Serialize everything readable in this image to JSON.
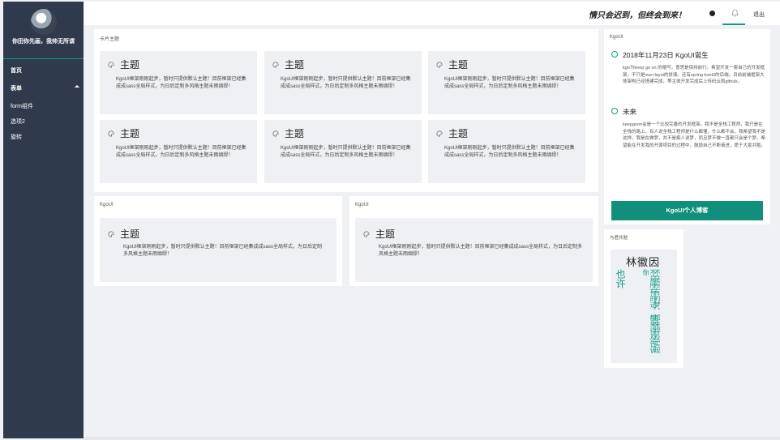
{
  "sidebar": {
    "user_name": "你田你先画，我帅无所谓",
    "items": [
      {
        "label": "首页"
      },
      {
        "label": "表单"
      },
      {
        "label": "form组件"
      },
      {
        "label": "选项2"
      },
      {
        "label": "旋转"
      }
    ]
  },
  "header": {
    "slogan": "情只会迟到，但终会到来！",
    "logout": "退出"
  },
  "theme_panel": {
    "title": "卡片主题",
    "card_title": "主题",
    "card_text": "KgoUI框架刚刚起步，暂时只提供默认主题！目前框架已经集成成sass全局样式，为日后定制多风格主题未雨绸缪！"
  },
  "panel_left": {
    "title": "KgoUI",
    "card_title": "主题",
    "card_text": "KgoUI框架刚刚起步，暂时只提供默认主题！目前框架已经集成成sass全局样式，为日后定制多风格主题未雨绸缪！"
  },
  "panel_right": {
    "title": "KgoUI",
    "card_title": "主题",
    "card_text": "KgoUI框架刚刚起步，暂时只提供默认主题！目前框架已经集成成sass全局样式，为日后定制多风格主题未雨绸缪！"
  },
  "timeline": {
    "title": "KgoUI",
    "item1_title": "2018年11月23日 KgoUI诞生",
    "item1_text": "kgo为keep go on 的缩写，意思是保持前行。希望开发一套自己的开发框架，不只是vue+layui的拼凑。还有spring boot2的后端。目前前端框架大体架构已经搭建完成，等主体开发完成后上传码云和github。",
    "item2_title": "未来",
    "item2_text": "keepgoon会是一个比较完善的开发框架。我不是全栈工程师，我只是在全栈的路上。有人说全栈工程师是什么都懂，什么都不会，我希望我不是这样。我是在做梦，并不是痴人说梦，而且梦不做一直都只会是个梦。希望能在开发我的开源项目的过程中，鼓励自己不断奋进，愿于大家共勉。",
    "button": "KgoUI个人博客"
  },
  "poem": {
    "panel_title": "与君共勉",
    "author": "林徽因",
    "col1": "不是所有的梦，都来得及实现",
    "col2": "不是所有的话，都来得及告诉你",
    "col3": "也许"
  },
  "colors": {
    "accent": "#0f9b84",
    "sidebar_bg": "#2f3b4c"
  }
}
